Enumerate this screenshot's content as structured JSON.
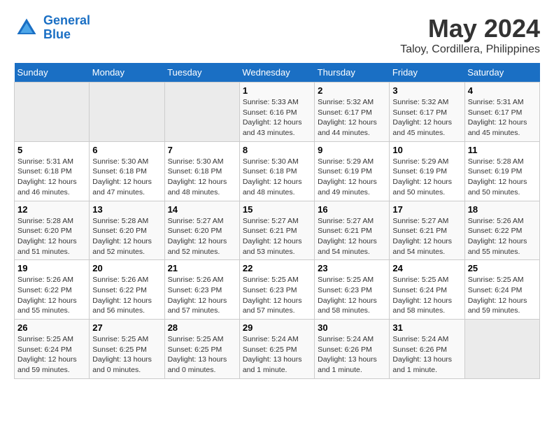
{
  "logo": {
    "line1": "General",
    "line2": "Blue"
  },
  "title": "May 2024",
  "location": "Taloy, Cordillera, Philippines",
  "days_of_week": [
    "Sunday",
    "Monday",
    "Tuesday",
    "Wednesday",
    "Thursday",
    "Friday",
    "Saturday"
  ],
  "weeks": [
    [
      {
        "day": "",
        "info": ""
      },
      {
        "day": "",
        "info": ""
      },
      {
        "day": "",
        "info": ""
      },
      {
        "day": "1",
        "info": "Sunrise: 5:33 AM\nSunset: 6:16 PM\nDaylight: 12 hours\nand 43 minutes."
      },
      {
        "day": "2",
        "info": "Sunrise: 5:32 AM\nSunset: 6:17 PM\nDaylight: 12 hours\nand 44 minutes."
      },
      {
        "day": "3",
        "info": "Sunrise: 5:32 AM\nSunset: 6:17 PM\nDaylight: 12 hours\nand 45 minutes."
      },
      {
        "day": "4",
        "info": "Sunrise: 5:31 AM\nSunset: 6:17 PM\nDaylight: 12 hours\nand 45 minutes."
      }
    ],
    [
      {
        "day": "5",
        "info": "Sunrise: 5:31 AM\nSunset: 6:18 PM\nDaylight: 12 hours\nand 46 minutes."
      },
      {
        "day": "6",
        "info": "Sunrise: 5:30 AM\nSunset: 6:18 PM\nDaylight: 12 hours\nand 47 minutes."
      },
      {
        "day": "7",
        "info": "Sunrise: 5:30 AM\nSunset: 6:18 PM\nDaylight: 12 hours\nand 48 minutes."
      },
      {
        "day": "8",
        "info": "Sunrise: 5:30 AM\nSunset: 6:18 PM\nDaylight: 12 hours\nand 48 minutes."
      },
      {
        "day": "9",
        "info": "Sunrise: 5:29 AM\nSunset: 6:19 PM\nDaylight: 12 hours\nand 49 minutes."
      },
      {
        "day": "10",
        "info": "Sunrise: 5:29 AM\nSunset: 6:19 PM\nDaylight: 12 hours\nand 50 minutes."
      },
      {
        "day": "11",
        "info": "Sunrise: 5:28 AM\nSunset: 6:19 PM\nDaylight: 12 hours\nand 50 minutes."
      }
    ],
    [
      {
        "day": "12",
        "info": "Sunrise: 5:28 AM\nSunset: 6:20 PM\nDaylight: 12 hours\nand 51 minutes."
      },
      {
        "day": "13",
        "info": "Sunrise: 5:28 AM\nSunset: 6:20 PM\nDaylight: 12 hours\nand 52 minutes."
      },
      {
        "day": "14",
        "info": "Sunrise: 5:27 AM\nSunset: 6:20 PM\nDaylight: 12 hours\nand 52 minutes."
      },
      {
        "day": "15",
        "info": "Sunrise: 5:27 AM\nSunset: 6:21 PM\nDaylight: 12 hours\nand 53 minutes."
      },
      {
        "day": "16",
        "info": "Sunrise: 5:27 AM\nSunset: 6:21 PM\nDaylight: 12 hours\nand 54 minutes."
      },
      {
        "day": "17",
        "info": "Sunrise: 5:27 AM\nSunset: 6:21 PM\nDaylight: 12 hours\nand 54 minutes."
      },
      {
        "day": "18",
        "info": "Sunrise: 5:26 AM\nSunset: 6:22 PM\nDaylight: 12 hours\nand 55 minutes."
      }
    ],
    [
      {
        "day": "19",
        "info": "Sunrise: 5:26 AM\nSunset: 6:22 PM\nDaylight: 12 hours\nand 55 minutes."
      },
      {
        "day": "20",
        "info": "Sunrise: 5:26 AM\nSunset: 6:22 PM\nDaylight: 12 hours\nand 56 minutes."
      },
      {
        "day": "21",
        "info": "Sunrise: 5:26 AM\nSunset: 6:23 PM\nDaylight: 12 hours\nand 57 minutes."
      },
      {
        "day": "22",
        "info": "Sunrise: 5:25 AM\nSunset: 6:23 PM\nDaylight: 12 hours\nand 57 minutes."
      },
      {
        "day": "23",
        "info": "Sunrise: 5:25 AM\nSunset: 6:23 PM\nDaylight: 12 hours\nand 58 minutes."
      },
      {
        "day": "24",
        "info": "Sunrise: 5:25 AM\nSunset: 6:24 PM\nDaylight: 12 hours\nand 58 minutes."
      },
      {
        "day": "25",
        "info": "Sunrise: 5:25 AM\nSunset: 6:24 PM\nDaylight: 12 hours\nand 59 minutes."
      }
    ],
    [
      {
        "day": "26",
        "info": "Sunrise: 5:25 AM\nSunset: 6:24 PM\nDaylight: 12 hours\nand 59 minutes."
      },
      {
        "day": "27",
        "info": "Sunrise: 5:25 AM\nSunset: 6:25 PM\nDaylight: 13 hours\nand 0 minutes."
      },
      {
        "day": "28",
        "info": "Sunrise: 5:25 AM\nSunset: 6:25 PM\nDaylight: 13 hours\nand 0 minutes."
      },
      {
        "day": "29",
        "info": "Sunrise: 5:24 AM\nSunset: 6:25 PM\nDaylight: 13 hours\nand 1 minute."
      },
      {
        "day": "30",
        "info": "Sunrise: 5:24 AM\nSunset: 6:26 PM\nDaylight: 13 hours\nand 1 minute."
      },
      {
        "day": "31",
        "info": "Sunrise: 5:24 AM\nSunset: 6:26 PM\nDaylight: 13 hours\nand 1 minute."
      },
      {
        "day": "",
        "info": ""
      }
    ]
  ]
}
